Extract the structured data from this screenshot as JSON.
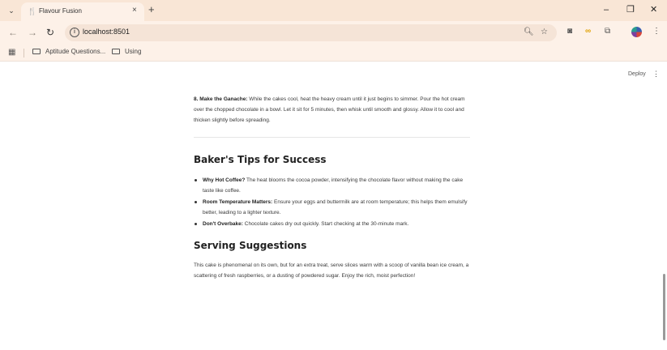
{
  "browser": {
    "tab_title": "Flavour Fusion",
    "tab_favicon": "fork-knife-icon",
    "tab_close": "×",
    "new_tab": "+",
    "minimize": "–",
    "restore": "❐",
    "close": "✕",
    "back": "←",
    "forward": "→",
    "reload": "↻",
    "url": "localhost:8501",
    "bookmarks": [
      {
        "label": "Aptitude Questions..."
      },
      {
        "label": "Using"
      }
    ]
  },
  "app": {
    "deploy_label": "Deploy",
    "menu_icon": "⋮"
  },
  "content": {
    "step8_label": "8. Make the Ganache:",
    "step8_text": " While the cakes cool, heat the heavy cream until it just begins to simmer. Pour the hot cream over the chopped chocolate in a bowl. Let it sit for 5 minutes, then whisk until smooth and glossy. Allow it to cool and thicken slightly before spreading.",
    "tips_heading": "Baker's Tips for Success",
    "tips": [
      {
        "label": "Why Hot Coffee?",
        "text": " The heat blooms the cocoa powder, intensifying the chocolate flavor without making the cake taste like coffee."
      },
      {
        "label": "Room Temperature Matters:",
        "text": " Ensure your eggs and buttermilk are at room temperature; this helps them emulsify better, leading to a lighter texture."
      },
      {
        "label": "Don't Overbake:",
        "text": " Chocolate cakes dry out quickly. Start checking at the 30-minute mark."
      }
    ],
    "serving_heading": "Serving Suggestions",
    "serving_text": "This cake is phenomenal on its own, but for an extra treat, serve slices warm with a scoop of vanilla bean ice cream, a scattering of fresh raspberries, or a dusting of powdered sugar. Enjoy the rich, moist perfection!"
  }
}
